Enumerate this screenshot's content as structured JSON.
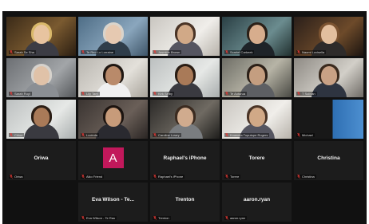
{
  "meeting": {
    "tiles": [
      {
        "name": "Sarah Se Sha",
        "type": "video",
        "theme": "warm"
      },
      {
        "name": "Te Reo Lo Lorraine",
        "type": "video",
        "theme": "blue"
      },
      {
        "name": "Jasmine Brown",
        "type": "video",
        "theme": "light"
      },
      {
        "name": "Scarlet Carkeek",
        "type": "video",
        "theme": "teal"
      },
      {
        "name": "Naomi Lovisella",
        "type": "video",
        "theme": "dark"
      },
      {
        "name": "Sarah Ruyl",
        "type": "video",
        "theme": "gray"
      },
      {
        "name": "Lily Tam",
        "type": "video",
        "theme": "office"
      },
      {
        "name": "Kirk Selby",
        "type": "video",
        "theme": "pale"
      },
      {
        "name": "Te Aotarua",
        "type": "video",
        "theme": "lab",
        "active": true
      },
      {
        "name": "T Sulivan",
        "type": "video",
        "theme": "office2"
      },
      {
        "name": "Chloe",
        "type": "video",
        "theme": "pale"
      },
      {
        "name": "Lucinda",
        "type": "video",
        "theme": "warm2"
      },
      {
        "name": "Caroline Lowry",
        "type": "video",
        "theme": "room"
      },
      {
        "name": "Koawma Tuputupe Rogers",
        "type": "video",
        "theme": "light"
      },
      {
        "name": "Michael",
        "type": "video",
        "theme": "blue2"
      },
      {
        "name": "Oriwa",
        "type": "name",
        "label": "Oriwa"
      },
      {
        "name": "Aiko Friend",
        "type": "avatar",
        "initial": "A"
      },
      {
        "name": "Raphael's iPhone",
        "type": "name",
        "label": "Raphael's iPhone"
      },
      {
        "name": "Torere",
        "type": "name",
        "label": "Torere"
      },
      {
        "name": "Christina",
        "type": "name",
        "label": "Christina"
      },
      {
        "name": "",
        "type": "empty"
      },
      {
        "name": "Eva Wilson - Te Rau",
        "type": "name",
        "label": "Eva Wilson - Te..."
      },
      {
        "name": "Trenton",
        "type": "name",
        "label": "Trenton"
      },
      {
        "name": "aaron.ryan",
        "type": "name",
        "label": "aaron.ryan"
      },
      {
        "name": "",
        "type": "empty"
      }
    ]
  },
  "colors": {
    "window_bg": "#111111",
    "tile_bg": "#1c1c1c",
    "avatar_bg": "#c2185b",
    "active_outline": "#d8d45a",
    "muted_mic": "#e53935"
  }
}
